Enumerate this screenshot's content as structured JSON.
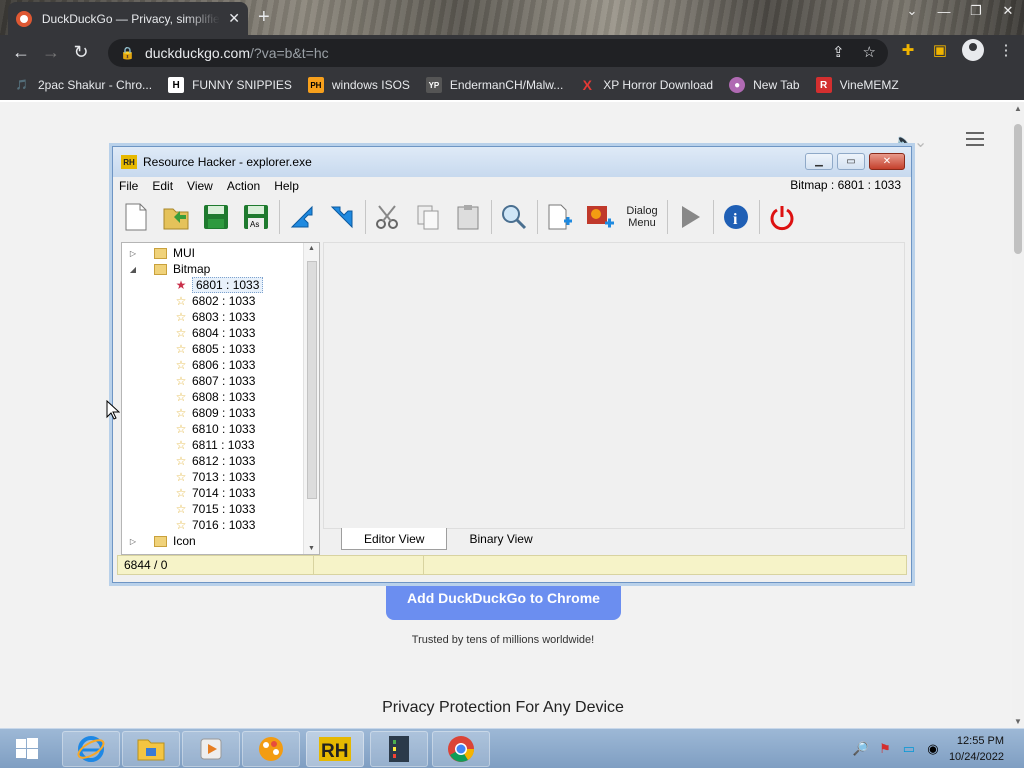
{
  "browser": {
    "tab": {
      "title": "DuckDuckGo — Privacy, simplified.",
      "close": "✕"
    },
    "new_tab": "+",
    "window_controls": [
      "⌄",
      "—",
      "❐",
      "✕"
    ],
    "url_host": "duckduckgo.com",
    "url_path": "/?va=b&t=hc",
    "bookmarks": [
      {
        "label": "2pac Shakur - Chro...",
        "icon": "folder-icon",
        "color": "#c46b2a",
        "glyph": "🎵"
      },
      {
        "label": "FUNNY SNIPPIES",
        "icon": "h-logo-icon",
        "color": "#ffffff",
        "glyph": "H"
      },
      {
        "label": "windows ISOS",
        "icon": "ph-logo-icon",
        "color": "#f7a01c",
        "glyph": "PH"
      },
      {
        "label": "EndermanCH/Malw...",
        "icon": "yp-logo-icon",
        "color": "#555555",
        "glyph": "YP"
      },
      {
        "label": "XP Horror Download",
        "icon": "x-logo-icon",
        "color": "#e53935",
        "glyph": "X"
      },
      {
        "label": "New Tab",
        "icon": "globe-icon",
        "color": "#b06ab3",
        "glyph": "●"
      },
      {
        "label": "VineMEMZ",
        "icon": "r-logo-icon",
        "color": "#d32f2f",
        "glyph": "R"
      }
    ]
  },
  "page": {
    "cta": "Add DuckDuckGo to Chrome",
    "trust": "Trusted by tens of millions worldwide!",
    "heading": "Privacy Protection For Any Device"
  },
  "rh": {
    "title": "Resource Hacker - explorer.exe",
    "menu": [
      "File",
      "Edit",
      "View",
      "Action",
      "Help"
    ],
    "status_right": "Bitmap : 6801 : 1033",
    "toolbar_dialog_label_1": "Dialog",
    "toolbar_dialog_label_2": "Menu",
    "tree": {
      "top_folders": [
        "MUI",
        "Bitmap"
      ],
      "items": [
        "6801 : 1033",
        "6802 : 1033",
        "6803 : 1033",
        "6804 : 1033",
        "6805 : 1033",
        "6806 : 1033",
        "6807 : 1033",
        "6808 : 1033",
        "6809 : 1033",
        "6810 : 1033",
        "6811 : 1033",
        "6812 : 1033",
        "7013 : 1033",
        "7014 : 1033",
        "7015 : 1033",
        "7016 : 1033"
      ],
      "bottom_folder": "Icon"
    },
    "tabs": [
      "Editor View",
      "Binary View"
    ],
    "status_left": "6844 / 0"
  },
  "taskbar": {
    "time": "12:55 PM",
    "date": "10/24/2022"
  }
}
